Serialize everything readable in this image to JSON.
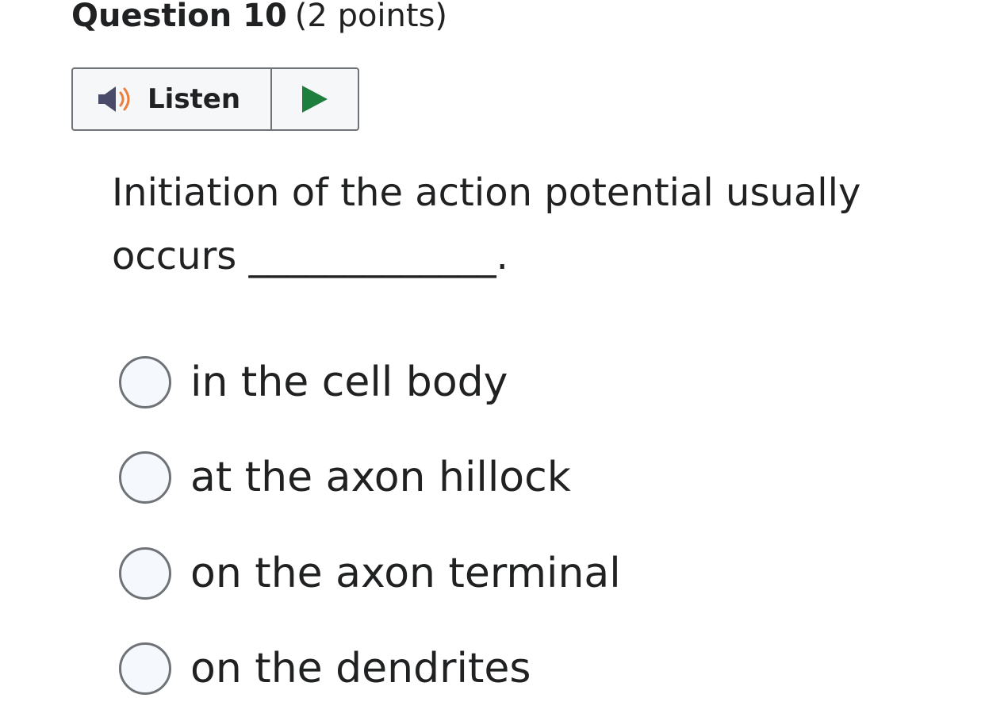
{
  "question": {
    "number_label": "Question 10",
    "points_label": "(2 points)",
    "text": "Initiation of the action potential usually occurs _____________."
  },
  "listen": {
    "label": "Listen",
    "icons": {
      "speaker": "speaker-icon",
      "play": "play-icon"
    },
    "colors": {
      "speaker": "#4a4a6a",
      "sound_waves": "#ef7d3a",
      "play": "#1e7e3e"
    }
  },
  "options": [
    {
      "label": "in the cell body",
      "selected": false
    },
    {
      "label": "at the axon hillock",
      "selected": false
    },
    {
      "label": "on the axon terminal",
      "selected": false
    },
    {
      "label": "on the dendrites",
      "selected": false
    }
  ]
}
